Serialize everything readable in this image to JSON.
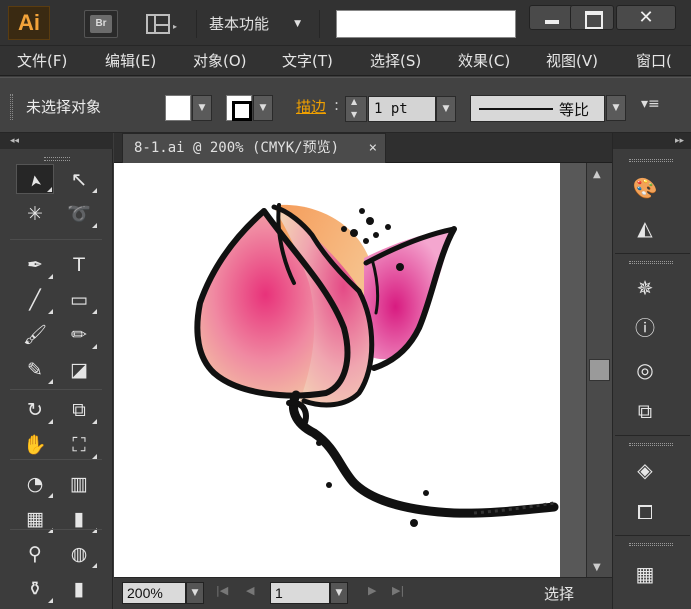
{
  "app": {
    "logo": "Ai",
    "bridge": "Br",
    "workspace": "基本功能",
    "search_placeholder": ""
  },
  "window": {
    "close": "✕"
  },
  "menu": [
    "文件(F)",
    "编辑(E)",
    "对象(O)",
    "文字(T)",
    "选择(S)",
    "效果(C)",
    "视图(V)",
    "窗口("
  ],
  "control": {
    "status": "未选择对象",
    "stroke_label": "描边",
    "stroke_colon": ":",
    "stroke_weight": "1 pt",
    "profile": "等比",
    "panel_menu": "▾≡"
  },
  "tools": [
    "selection-tool",
    "direct-selection-tool",
    "magic-wand-tool",
    "lasso-tool",
    "pen-tool",
    "type-tool",
    "line-segment-tool",
    "rectangle-tool",
    "paintbrush-tool",
    "pencil-tool",
    "blob-brush-tool",
    "eraser-tool",
    "rotate-tool",
    "scale-tool",
    "warp-tool",
    "free-transform-tool",
    "shape-builder-tool",
    "perspective-grid-tool",
    "mesh-tool",
    "gradient-tool",
    "eyedropper-tool",
    "blend-tool",
    "symbol-sprayer-tool",
    "column-graph-tool"
  ],
  "tool_glyphs": {
    "type-tool": "T"
  },
  "document": {
    "tab_title": "8-1.ai @ 200% (CMYK/预览)",
    "tab_close": "×"
  },
  "status": {
    "zoom": "200%",
    "page": "1",
    "text": "选择"
  },
  "panels": [
    "color-guide-icon",
    "gradient-icon",
    "symbols-icon",
    "info-icon",
    "appearance-icon",
    "transform-icon",
    "layers-icon",
    "artboards-icon",
    "swatches-icon"
  ],
  "colors": {
    "accent": "#f0a000",
    "petal_pink": "#e8327a",
    "petal_peach": "#f2c29a",
    "ink": "#111111"
  }
}
